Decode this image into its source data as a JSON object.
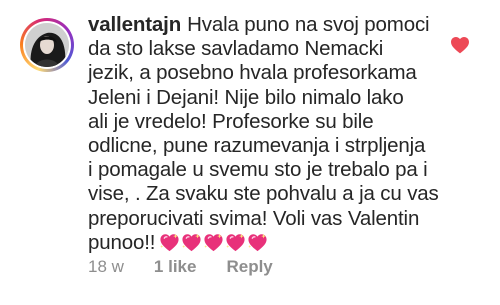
{
  "comment": {
    "username": "vallentajn",
    "text_lines": [
      "Hvala puno na svoj pomoci",
      "da sto lakse savladamo Nemacki",
      "jezik, a posebno hvala profesorkama",
      "Jeleni i Dejani! Nije bilo nimalo lako",
      "ali je vredelo! Profesorke su bile",
      "odlicne, pune razumevanja i strpljenja",
      "i pomagale u svemu sto je trebalo pa i",
      "vise, . Za svaku ste pohvalu a ja cu vas",
      "preporucivati svima! Voli vas Valentin",
      "punoo!!"
    ],
    "emoji": {
      "icon": "sparkling-heart",
      "count": 5,
      "color": "#e8317a"
    },
    "time": "18 w",
    "likes": "1 like",
    "reply_label": "Reply",
    "like_icon_color": "#ed4956"
  }
}
